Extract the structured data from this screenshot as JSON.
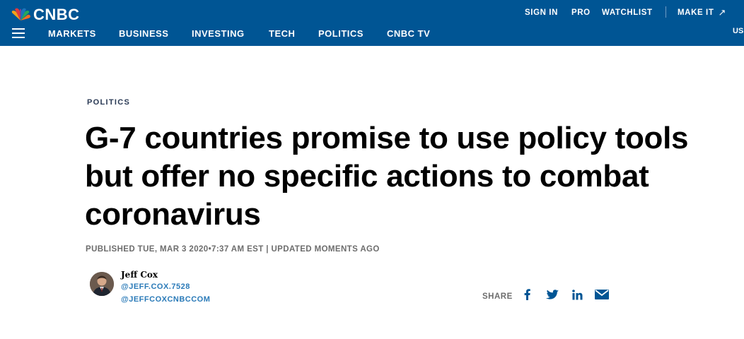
{
  "brand": {
    "name": "CNBC"
  },
  "utility_nav": {
    "sign_in": "SIGN IN",
    "pro": "PRO",
    "watchlist": "WATCHLIST",
    "make_it": "MAKE IT",
    "make_it_arrow": "↗"
  },
  "main_nav": {
    "items": [
      "MARKETS",
      "BUSINESS",
      "INVESTING",
      "TECH",
      "POLITICS",
      "CNBC TV"
    ],
    "edge_item": "US"
  },
  "article": {
    "category": "POLITICS",
    "headline": "G-7 countries promise to use policy tools but offer no specific actions to combat coronavirus",
    "timestamp": "PUBLISHED TUE, MAR 3 2020•7:37 AM EST | UPDATED MOMENTS AGO",
    "author": {
      "name": "Jeff Cox",
      "handles": [
        "@JEFF.COX.7528",
        "@JEFFCOXCNBCCOM"
      ]
    }
  },
  "share": {
    "label": "SHARE",
    "icons": [
      "facebook-icon",
      "twitter-icon",
      "linkedin-icon",
      "email-icon"
    ]
  },
  "colors": {
    "header_bg": "#005594",
    "link": "#2a7ab8",
    "meta_gray": "#6d6d6d",
    "share_icon": "#005594"
  }
}
